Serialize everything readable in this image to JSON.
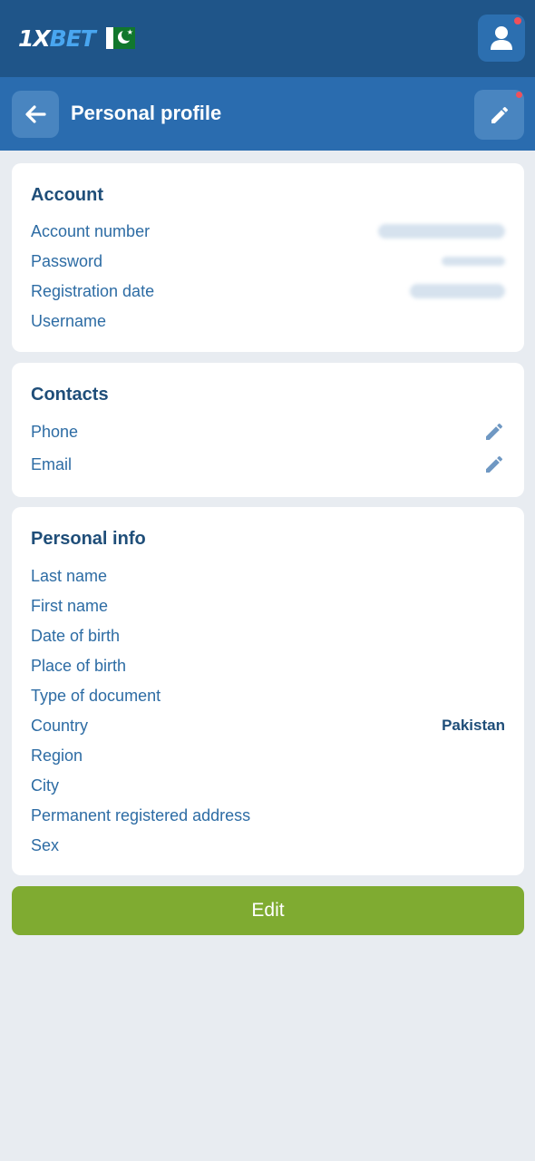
{
  "header": {
    "logo_1x": "1X",
    "logo_bet": "BET"
  },
  "title_bar": {
    "title": "Personal profile"
  },
  "account": {
    "title": "Account",
    "rows": [
      {
        "label": "Account number"
      },
      {
        "label": "Password"
      },
      {
        "label": "Registration date"
      },
      {
        "label": "Username"
      }
    ]
  },
  "contacts": {
    "title": "Contacts",
    "rows": [
      {
        "label": "Phone"
      },
      {
        "label": "Email"
      }
    ]
  },
  "personal_info": {
    "title": "Personal info",
    "rows": [
      {
        "label": "Last name",
        "value": ""
      },
      {
        "label": "First name",
        "value": ""
      },
      {
        "label": "Date of birth",
        "value": ""
      },
      {
        "label": "Place of birth",
        "value": ""
      },
      {
        "label": "Type of document",
        "value": ""
      },
      {
        "label": "Country",
        "value": "Pakistan"
      },
      {
        "label": "Region",
        "value": ""
      },
      {
        "label": "City",
        "value": ""
      },
      {
        "label": "Permanent registered address",
        "value": ""
      },
      {
        "label": "Sex",
        "value": ""
      }
    ]
  },
  "footer": {
    "edit_label": "Edit"
  },
  "colors": {
    "header_bg": "#1f5589",
    "title_bar_bg": "#2a6caf",
    "page_bg": "#e8ecf1",
    "accent_green": "#7fab31",
    "notification_dot": "#f0505a"
  },
  "icons": [
    "pakistan-flag-icon",
    "user-icon",
    "back-arrow-icon",
    "pencil-icon"
  ]
}
